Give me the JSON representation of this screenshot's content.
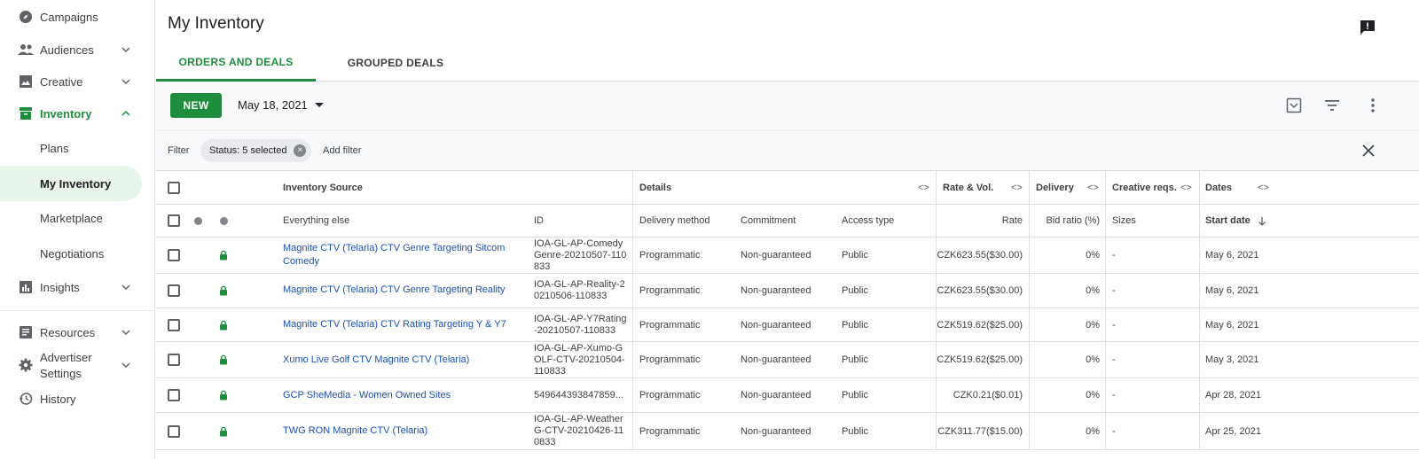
{
  "sidebar": {
    "items": [
      {
        "label": "Campaigns",
        "icon": "compass-icon",
        "chevron": false
      },
      {
        "label": "Audiences",
        "icon": "people-icon",
        "chevron": true
      },
      {
        "label": "Creative",
        "icon": "image-icon",
        "chevron": true
      },
      {
        "label": "Inventory",
        "icon": "inventory-icon",
        "chevron": true,
        "active": true
      },
      {
        "label": "Plans"
      },
      {
        "label": "My Inventory",
        "selected": true
      },
      {
        "label": "Marketplace"
      },
      {
        "label": "Negotiations"
      },
      {
        "label": "Insights",
        "icon": "insights-icon",
        "chevron": true
      },
      {
        "label": "Resources",
        "icon": "resources-icon",
        "chevron": true
      },
      {
        "label": "Advertiser",
        "label2": "Settings",
        "icon": "gear-icon",
        "chevron": true
      },
      {
        "label": "History",
        "icon": "history-icon",
        "chevron": false
      }
    ]
  },
  "page": {
    "title": "My Inventory",
    "tabs": [
      "ORDERS AND DEALS",
      "GROUPED DEALS"
    ]
  },
  "toolbar": {
    "new_label": "NEW",
    "date": "May 18, 2021"
  },
  "filter": {
    "label": "Filter",
    "chip": "Status: 5 selected",
    "add": "Add filter"
  },
  "table": {
    "group_headers": {
      "source": "Inventory Source",
      "details": "Details",
      "rate": "Rate & Vol.",
      "delivery": "Delivery",
      "creative": "Creative reqs.",
      "dates": "Dates"
    },
    "expand_glyph": "<>",
    "columns": {
      "everything_else": "Everything else",
      "id": "ID",
      "delivery_method": "Delivery method",
      "commitment": "Commitment",
      "access_type": "Access type",
      "rate": "Rate",
      "bid_ratio": "Bid ratio (%)",
      "sizes": "Sizes",
      "start_date": "Start date"
    },
    "rows": [
      {
        "name": "Magnite CTV (Telaria) CTV Genre Targeting Sitcom Comedy",
        "id": "IOA-GL-AP-ComedyGenre-20210507-110833",
        "delivery_method": "Programmatic",
        "commitment": "Non-guaranteed",
        "access": "Public",
        "rate": "CZK623.55($30.00)",
        "bid_ratio": "0%",
        "sizes": "-",
        "start": "May 6, 2021"
      },
      {
        "name": "Magnite CTV (Telaria) CTV Genre Targeting Reality",
        "id": "IOA-GL-AP-Reality-20210506-110833",
        "delivery_method": "Programmatic",
        "commitment": "Non-guaranteed",
        "access": "Public",
        "rate": "CZK623.55($30.00)",
        "bid_ratio": "0%",
        "sizes": "-",
        "start": "May 6, 2021"
      },
      {
        "name": "Magnite CTV (Telaria) CTV Rating Targeting Y & Y7",
        "id": "IOA-GL-AP-Y7Rating-20210507-110833",
        "delivery_method": "Programmatic",
        "commitment": "Non-guaranteed",
        "access": "Public",
        "rate": "CZK519.62($25.00)",
        "bid_ratio": "0%",
        "sizes": "-",
        "start": "May 6, 2021"
      },
      {
        "name": "Xumo Live Golf CTV Magnite CTV (Telaria)",
        "id": "IOA-GL-AP-Xumo-GOLF-CTV-20210504-110833",
        "delivery_method": "Programmatic",
        "commitment": "Non-guaranteed",
        "access": "Public",
        "rate": "CZK519.62($25.00)",
        "bid_ratio": "0%",
        "sizes": "-",
        "start": "May 3, 2021"
      },
      {
        "name": "GCP SheMedia - Women Owned Sites",
        "id": "549644393847859...",
        "delivery_method": "Programmatic",
        "commitment": "Non-guaranteed",
        "access": "Public",
        "rate": "CZK0.21($0.01)",
        "bid_ratio": "0%",
        "sizes": "-",
        "start": "Apr 28, 2021"
      },
      {
        "name": "TWG RON Magnite CTV (Telaria)",
        "id": "IOA-GL-AP-WeatherG-CTV-20210426-110833",
        "delivery_method": "Programmatic",
        "commitment": "Non-guaranteed",
        "access": "Public",
        "rate": "CZK311.77($15.00)",
        "bid_ratio": "0%",
        "sizes": "-",
        "start": "Apr 25, 2021"
      }
    ]
  },
  "colors": {
    "accent": "#1e8e3e",
    "link": "#1a4fb5",
    "selected_bg": "#e6f4ea"
  }
}
